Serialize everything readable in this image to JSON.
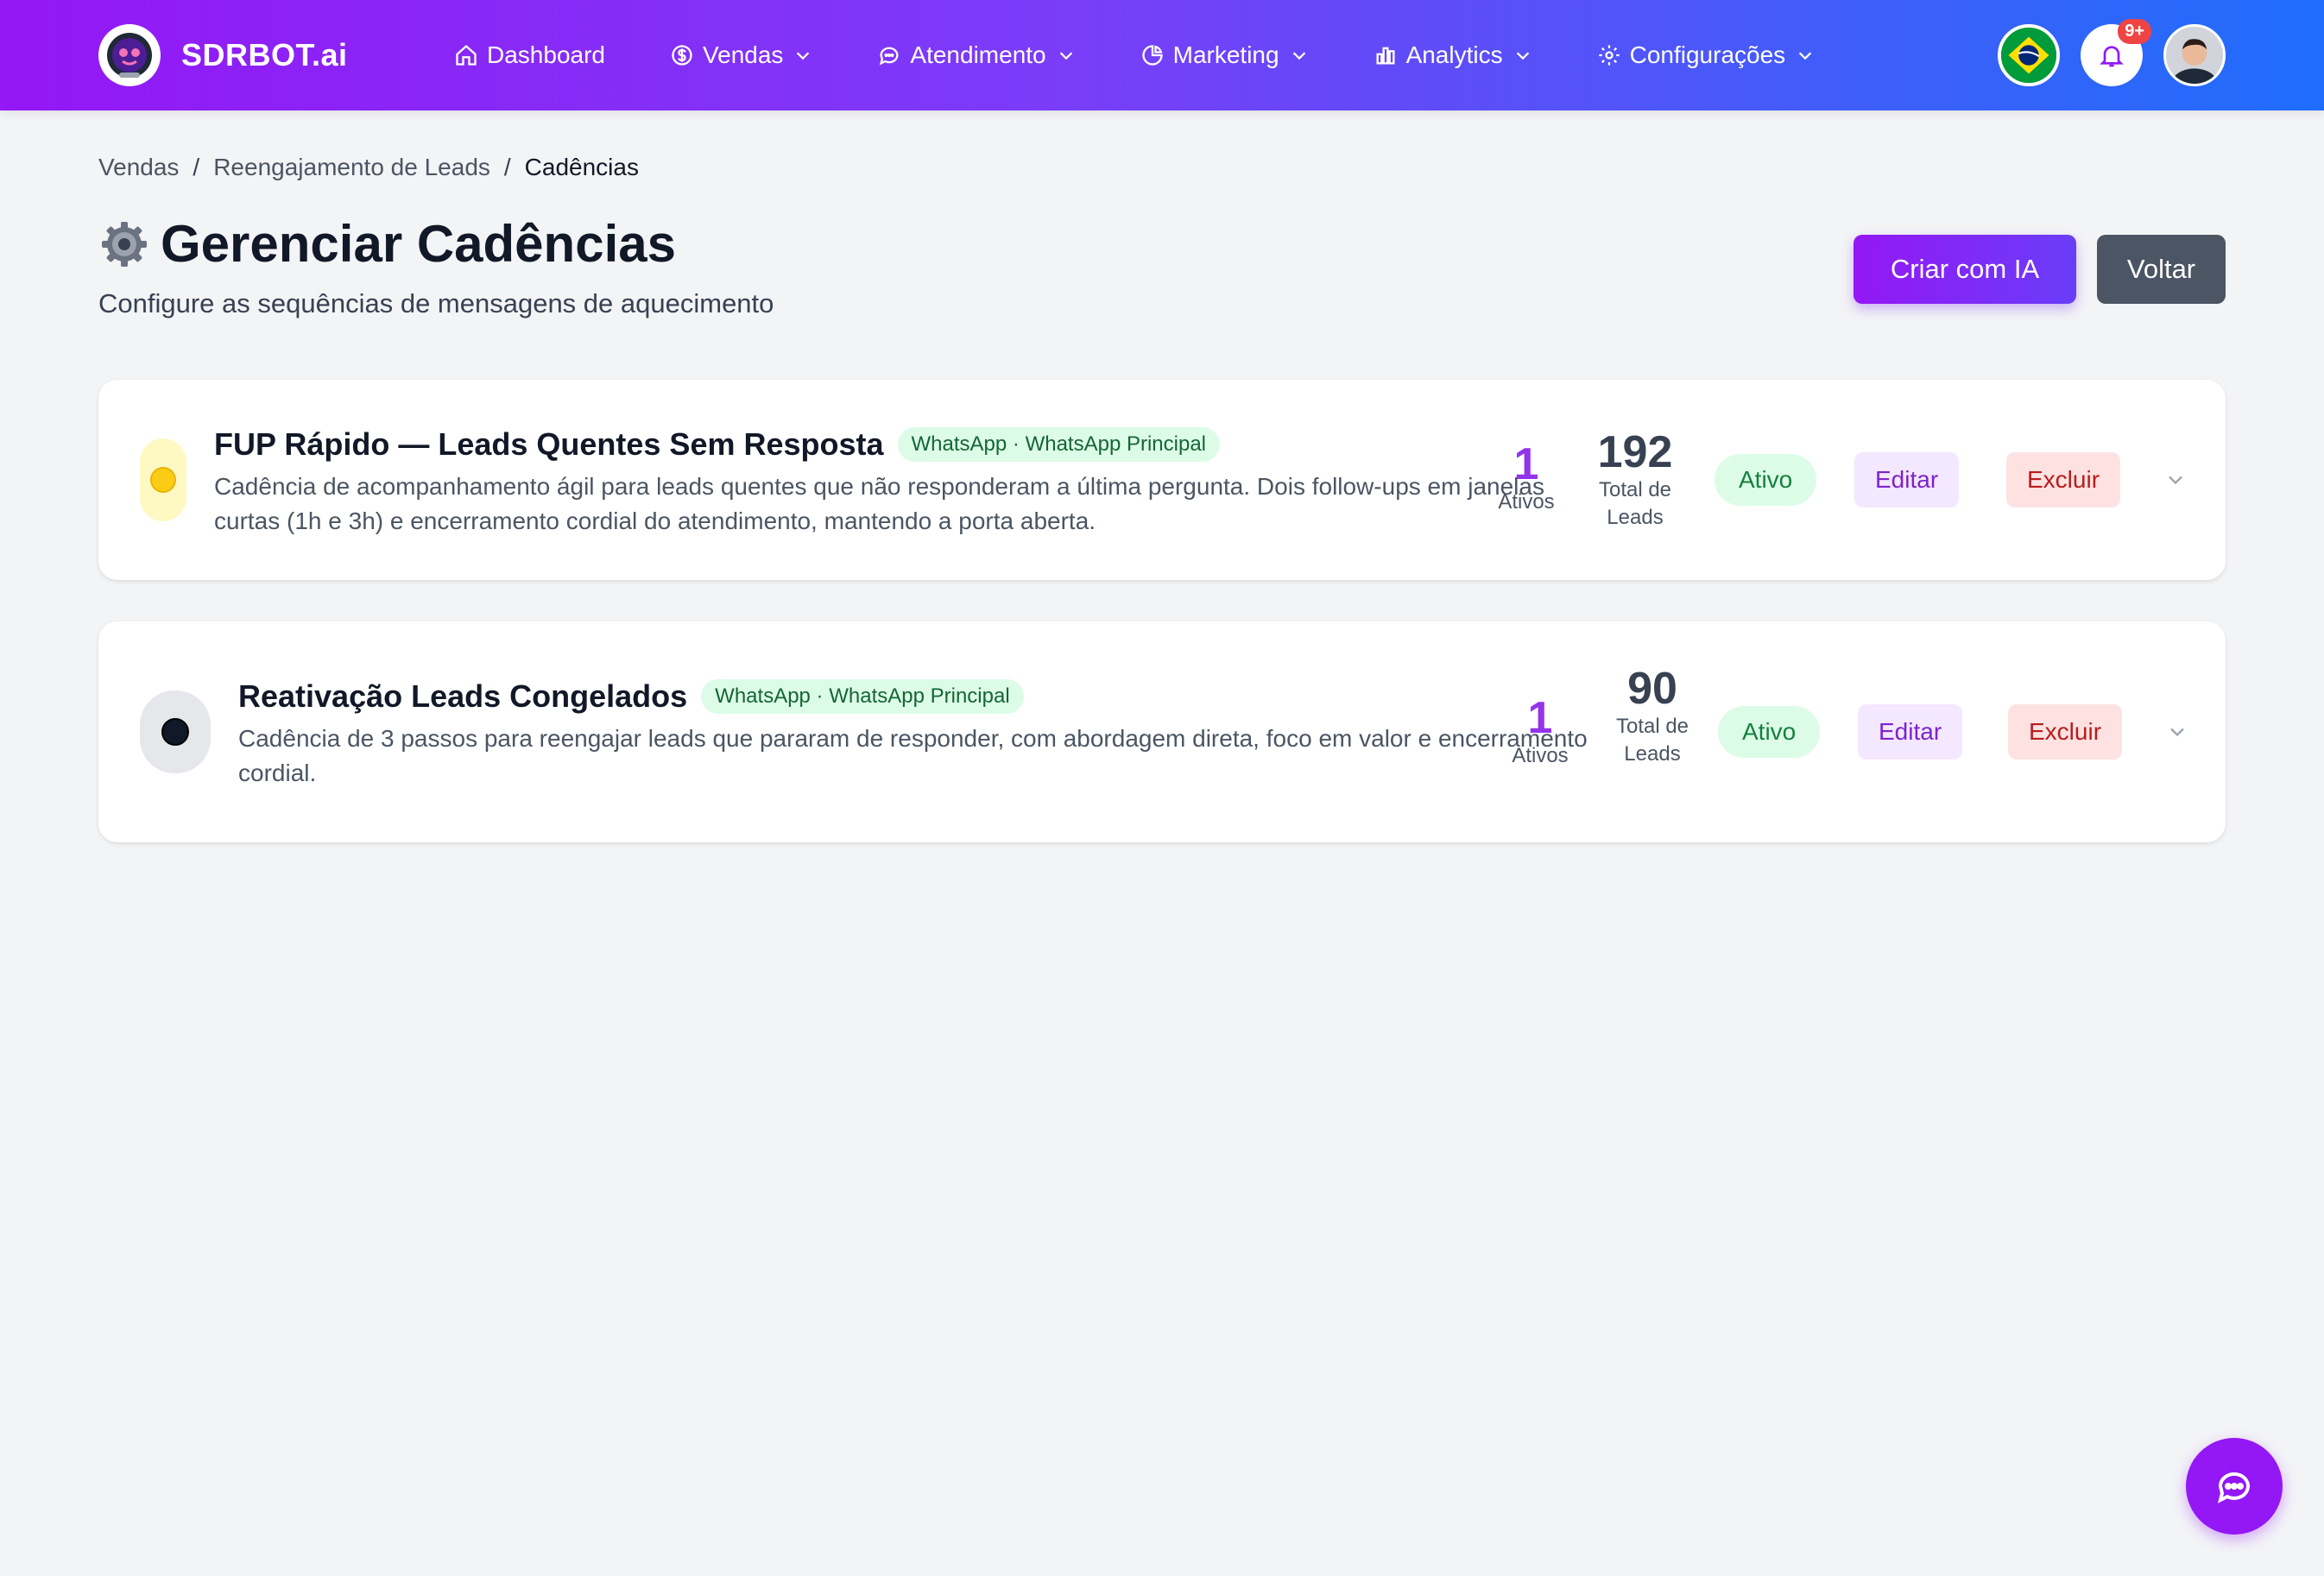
{
  "brand": {
    "name": "SDRBOT.ai"
  },
  "nav": [
    {
      "label": "Dashboard",
      "icon": "home-icon",
      "dropdown": false
    },
    {
      "label": "Vendas",
      "icon": "dollar-icon",
      "dropdown": true
    },
    {
      "label": "Atendimento",
      "icon": "chat-icon",
      "dropdown": true
    },
    {
      "label": "Marketing",
      "icon": "pie-chart-icon",
      "dropdown": true
    },
    {
      "label": "Analytics",
      "icon": "bar-chart-icon",
      "dropdown": true
    },
    {
      "label": "Configurações",
      "icon": "gear-icon",
      "dropdown": true
    }
  ],
  "header_right": {
    "notifications_count": "9+"
  },
  "breadcrumb": [
    "Vendas",
    "Reengajamento de Leads",
    "Cadências"
  ],
  "page": {
    "title": "Gerenciar Cadências",
    "subtitle": "Configure as sequências de mensagens de aquecimento",
    "create_ai_label": "Criar com IA",
    "back_label": "Voltar"
  },
  "cadences": [
    {
      "title": "FUP Rápido — Leads Quentes Sem Resposta",
      "channel": "WhatsApp · WhatsApp Principal",
      "description": "Cadência de acompanhamento ágil para leads quentes que não responderam a última pergunta. Dois follow-ups em janelas curtas (1h e 3h) e encerramento cordial do atendimento, mantendo a porta aberta.",
      "active_count": "1",
      "active_label": "Ativos",
      "total_leads": "192",
      "total_label": "Total de Leads",
      "status": "Ativo",
      "edit_label": "Editar",
      "delete_label": "Excluir",
      "color": "#facc15"
    },
    {
      "title": "Reativação Leads Congelados",
      "channel": "WhatsApp · WhatsApp Principal",
      "description": "Cadência de 3 passos para reengajar leads que pararam de responder, com abordagem direta, foco em valor e encerramento cordial.",
      "active_count": "1",
      "active_label": "Ativos",
      "total_leads": "90",
      "total_label": "Total de Leads",
      "status": "Ativo",
      "edit_label": "Editar",
      "delete_label": "Excluir",
      "color": "#111827"
    }
  ],
  "colors": {
    "brand_purple": "#9417f5",
    "brand_blue": "#1f6dfb",
    "success": "#15803d",
    "danger": "#b91c1c"
  }
}
